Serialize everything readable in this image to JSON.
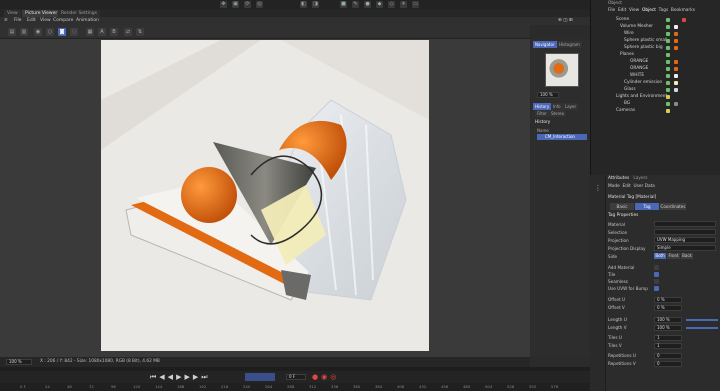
{
  "tabs": [
    "View",
    "Picture Viewer",
    "Render Settings"
  ],
  "menus": [
    "File",
    "Edit",
    "View",
    "Compare",
    "Animation"
  ],
  "pv_tool_letters": [
    "A",
    "B"
  ],
  "navigator": {
    "tabs": [
      "Navigator",
      "Histogram"
    ],
    "zoom": "100 %",
    "history_tabs": [
      "History",
      "Info",
      "Layer",
      "Filter",
      "Stereo"
    ],
    "history_title": "History",
    "history_col": "Name",
    "history_item": "CM_Interaction"
  },
  "status": {
    "zoom": "100 %",
    "info": "X : 206 / Y: 842 - Size: 1080x1080, RGB (8 Bit), 4.62 MB"
  },
  "timeline": {
    "frame_start": "0 F",
    "frame_current": "0 F",
    "ruler": [
      "24",
      "48",
      "72",
      "96",
      "120",
      "144",
      "168",
      "192",
      "216",
      "240",
      "264",
      "288",
      "312",
      "336",
      "360",
      "384",
      "408",
      "432",
      "456",
      "480",
      "504",
      "528",
      "552",
      "576"
    ]
  },
  "object_manager": {
    "header": "Object",
    "menus": [
      "File",
      "Edit",
      "View",
      "Object",
      "Tags",
      "Bookmarks"
    ],
    "objects": [
      {
        "name": "Scene",
        "depth": 0,
        "color": "#6fbf6f"
      },
      {
        "name": "Volume Mesher",
        "depth": 1,
        "color": "#6fbf6f"
      },
      {
        "name": "Wire",
        "depth": 2,
        "color": "#6fbf6f"
      },
      {
        "name": "Sphere plastic small",
        "depth": 2,
        "color": "#6fbf6f"
      },
      {
        "name": "Sphere plastic big",
        "depth": 2,
        "color": "#6fbf6f"
      },
      {
        "name": "Planes",
        "depth": 1,
        "color": "#6fbf6f"
      },
      {
        "name": "ORANGE",
        "depth": 3,
        "color": "#6fbf6f"
      },
      {
        "name": "ORANGE",
        "depth": 3,
        "color": "#6fbf6f"
      },
      {
        "name": "WHITE",
        "depth": 3,
        "color": "#6fbf6f"
      },
      {
        "name": "Cylinder emission",
        "depth": 2,
        "color": "#6fbf6f"
      },
      {
        "name": "Glass",
        "depth": 2,
        "color": "#6fbf6f"
      },
      {
        "name": "Lights and Environment",
        "depth": 0,
        "color": "#d8cf4f"
      },
      {
        "name": "BG",
        "depth": 1,
        "color": "#6fbf6f"
      },
      {
        "name": "Cameras",
        "depth": 0,
        "color": "#d8cf4f"
      }
    ]
  },
  "attributes": {
    "tabs": [
      "Attributes",
      "Layers"
    ],
    "menus": [
      "Mode",
      "Edit",
      "User Data"
    ],
    "title": "Material Tag [Material]",
    "sub_tabs": [
      "Basic",
      "Tag",
      "Coordinates"
    ],
    "section": "Tag Properties",
    "rows": [
      {
        "label": "Material",
        "value": ""
      },
      {
        "label": "Selection",
        "value": ""
      },
      {
        "label": "Projection",
        "value": "UVW Mapping"
      },
      {
        "label": "Projection Display",
        "value": "Simple"
      },
      {
        "label": "Side",
        "value": "Both"
      },
      {
        "label": "Add Material",
        "value": ""
      },
      {
        "label": "Tile",
        "value": ""
      },
      {
        "label": "Seamless",
        "value": ""
      },
      {
        "label": "Use UVW for Bump",
        "value": ""
      },
      {
        "label": "Offset U",
        "value": "0 %"
      },
      {
        "label": "Offset V",
        "value": "0 %"
      },
      {
        "label": "Length U",
        "value": "100 %"
      },
      {
        "label": "Length V",
        "value": "100 %"
      },
      {
        "label": "Tiles U",
        "value": "1"
      },
      {
        "label": "Tiles V",
        "value": "1"
      },
      {
        "label": "Repetitions U",
        "value": "0"
      },
      {
        "label": "Repetitions V",
        "value": "0"
      }
    ],
    "side_options": [
      "Both",
      "Front",
      "Back"
    ]
  },
  "colors": {
    "accent": "#4a67b8",
    "render_orange": "#e26a12"
  }
}
